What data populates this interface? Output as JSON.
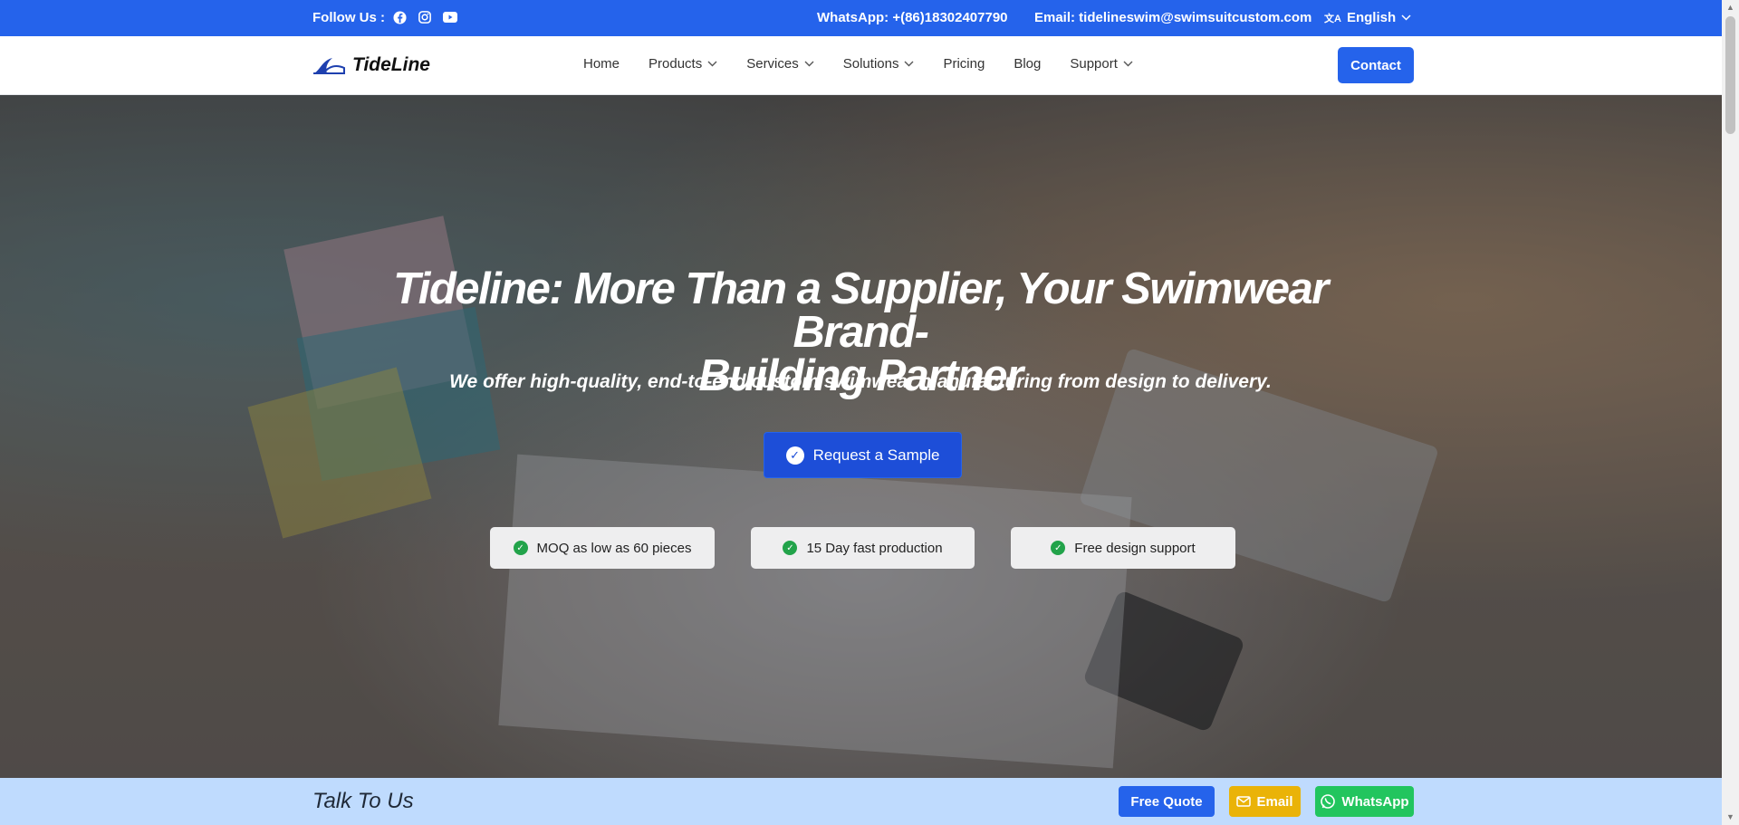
{
  "topbar": {
    "follow_label": "Follow Us :",
    "whatsapp": "WhatsApp:  +(86)18302407790",
    "email": "Email:  tidelineswim@swimsuitcustom.com",
    "language": "English"
  },
  "nav": {
    "brand": "TideLine",
    "items": [
      {
        "label": "Home",
        "dropdown": false
      },
      {
        "label": "Products",
        "dropdown": true
      },
      {
        "label": "Services",
        "dropdown": true
      },
      {
        "label": "Solutions",
        "dropdown": true
      },
      {
        "label": "Pricing",
        "dropdown": false
      },
      {
        "label": "Blog",
        "dropdown": false
      },
      {
        "label": "Support",
        "dropdown": true
      }
    ],
    "contact_label": "Contact"
  },
  "hero": {
    "title_line1": "Tideline: More Than a Supplier, Your Swimwear Brand-",
    "title_line2": "Building Partner",
    "subtitle": "We offer high-quality, end-to-end custom swimwear manufacturing from design to delivery.",
    "cta_label": "Request a Sample",
    "badges": [
      "MOQ as low as 60 pieces",
      "15 Day fast production",
      "Free design support"
    ]
  },
  "talkbar": {
    "title": "Talk To Us",
    "quote_label": "Free Quote",
    "email_label": "Email",
    "whatsapp_label": "WhatsApp"
  },
  "colors": {
    "primary": "#2563eb",
    "email_button": "#eab308",
    "whatsapp_button": "#22c55e",
    "talkbar_bg": "#bfdbfe",
    "badge_check": "#22a34a"
  }
}
